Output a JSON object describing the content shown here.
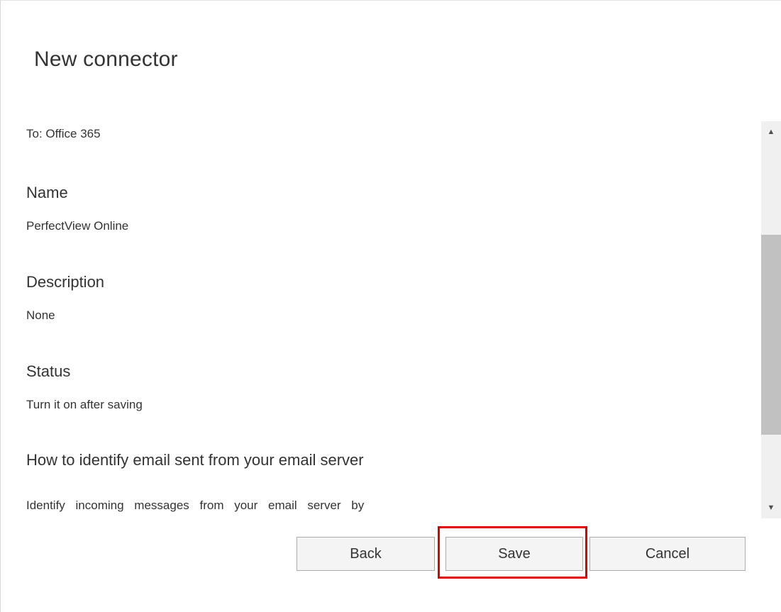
{
  "dialog": {
    "title": "New connector"
  },
  "summary": {
    "to_line": "To: Office 365",
    "fields": [
      {
        "label": "Name",
        "value": "PerfectView Online"
      },
      {
        "label": "Description",
        "value": "None"
      },
      {
        "label": "Status",
        "value": "Turn it on after saving"
      }
    ],
    "identify_label": "How to identify email sent from your email server",
    "identify_cut_text": "Identify incoming messages from your email server by"
  },
  "scrollbar": {
    "up_icon": "scroll-up-arrow-icon",
    "down_icon": "scroll-down-arrow-icon"
  },
  "buttons": {
    "back_label": "Back",
    "save_label": "Save",
    "cancel_label": "Cancel"
  },
  "colors": {
    "highlight": "#e00000",
    "button_bg": "#f4f4f4",
    "button_border": "#ababab",
    "scroll_thumb": "#c1c1c1"
  }
}
